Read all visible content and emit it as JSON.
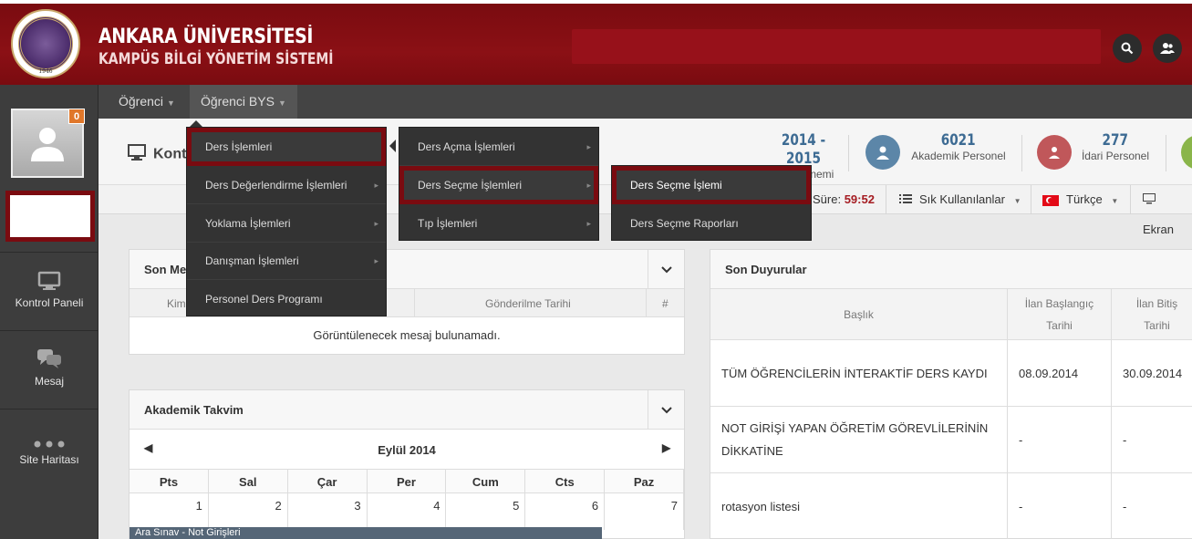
{
  "header": {
    "title_line1": "ANKARA ÜNİVERSİTESİ",
    "title_line2": "KAMPÜS BİLGİ YÖNETİM SİSTEMİ",
    "logo_year": "1946"
  },
  "sidebar": {
    "notification_count": "0",
    "items": [
      {
        "label": "Kontrol Paneli",
        "icon": "monitor-icon"
      },
      {
        "label": "Mesaj",
        "icon": "chat-icon"
      },
      {
        "label": "Site Haritası",
        "icon": "dots-icon"
      }
    ]
  },
  "topnav": {
    "items": [
      {
        "label": "Öğrenci"
      },
      {
        "label": "Öğrenci BYS"
      }
    ]
  },
  "page": {
    "title": "Kontrol Paneli",
    "title_visible": "Kont",
    "stats": {
      "donem_value": "2014 - 2015",
      "donem_label": "Güz Dönemi",
      "akademik_value": "6021",
      "akademik_label": "Akademik Personel",
      "idari_value": "277",
      "idari_label": "İdari Personel"
    }
  },
  "toolbar": {
    "sure_label": "Süre:",
    "sure_value": "59:52",
    "sik_label": "Sık Kullanılanlar",
    "lang_label": "Türkçe",
    "ekran_label": "Ekran"
  },
  "menus": {
    "level1": [
      {
        "label": "Ders İşlemleri"
      },
      {
        "label": "Ders Değerlendirme İşlemleri"
      },
      {
        "label": "Yoklama İşlemleri"
      },
      {
        "label": "Danışman İşlemleri"
      },
      {
        "label": "Personel Ders Programı"
      }
    ],
    "level2": [
      {
        "label": "Ders Açma İşlemleri"
      },
      {
        "label": "Ders Seçme İşlemleri"
      },
      {
        "label": "Tıp İşlemleri"
      }
    ],
    "level3": [
      {
        "label": "Ders Seçme İşlemi"
      },
      {
        "label": "Ders Seçme Raporları"
      }
    ]
  },
  "messages_panel": {
    "title": "Son Me",
    "col_kim": "Kim",
    "col_tarih": "Gönderilme Tarihi",
    "col_hash": "#",
    "empty_text": "Görüntülenecek mesaj bulunamadı."
  },
  "calendar_panel": {
    "title": "Akademik Takvim",
    "month": "Eylül 2014",
    "weekdays": [
      "Pts",
      "Sal",
      "Çar",
      "Per",
      "Cum",
      "Cts",
      "Paz"
    ],
    "days": [
      "1",
      "2",
      "3",
      "4",
      "5",
      "6",
      "7"
    ],
    "event": "Ara Sınav - Not Girişleri"
  },
  "announcements_panel": {
    "title": "Son Duyurular",
    "col_baslik": "Başlık",
    "col_baslangic": "İlan Başlangıç Tarihi",
    "col_bitis": "İlan Bitiş Tarihi",
    "rows": [
      {
        "title": "TÜM ÖĞRENCİLERİN İNTERAKTİF DERS KAYDI",
        "start": "08.09.2014",
        "end": "30.09.2014"
      },
      {
        "title": "NOT GİRİŞİ YAPAN ÖĞRETİM GÖREVLİLERİNİN DİKKATİNE",
        "start": "-",
        "end": "-"
      },
      {
        "title": "rotasyon listesi",
        "start": "-",
        "end": "-"
      }
    ]
  },
  "colors": {
    "brand": "#7a0b10",
    "highlight_border": "#7a0b10",
    "timer": "#a51c22",
    "stat_blue": "#3d6b93"
  }
}
